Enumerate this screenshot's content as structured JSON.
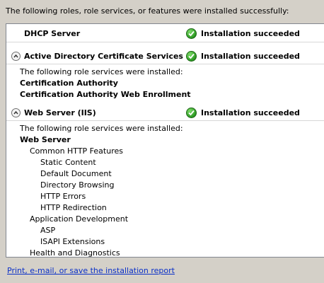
{
  "intro": "The following roles, role services, or features were installed successfully:",
  "rows": [
    {
      "title": "DHCP Server",
      "status": "Installation succeeded"
    },
    {
      "title": "Active Directory Certificate Services",
      "status": "Installation succeeded",
      "note": "The following role services were installed:",
      "services": [
        "Certification Authority",
        "Certification Authority Web Enrollment"
      ]
    },
    {
      "title": "Web Server (IIS)",
      "status": "Installation succeeded",
      "note": "The following role services were installed:",
      "top": "Web Server",
      "tree": [
        {
          "label": "Common HTTP Features",
          "level": 1
        },
        {
          "label": "Static Content",
          "level": 2
        },
        {
          "label": "Default Document",
          "level": 2
        },
        {
          "label": "Directory Browsing",
          "level": 2
        },
        {
          "label": "HTTP Errors",
          "level": 2
        },
        {
          "label": "HTTP Redirection",
          "level": 2
        },
        {
          "label": "Application Development",
          "level": 1
        },
        {
          "label": "ASP",
          "level": 2
        },
        {
          "label": "ISAPI Extensions",
          "level": 2
        },
        {
          "label": "Health and Diagnostics",
          "level": 1
        }
      ]
    }
  ],
  "report_link": "Print, e-mail, or save the installation report",
  "colors": {
    "link": "#0a30c8",
    "success": "#2d9a23",
    "panel_bg": "#ffffff",
    "window_bg": "#d4d0c8"
  },
  "icons": {
    "collapse": "chevron-up-icon",
    "status": "success-check-icon"
  }
}
